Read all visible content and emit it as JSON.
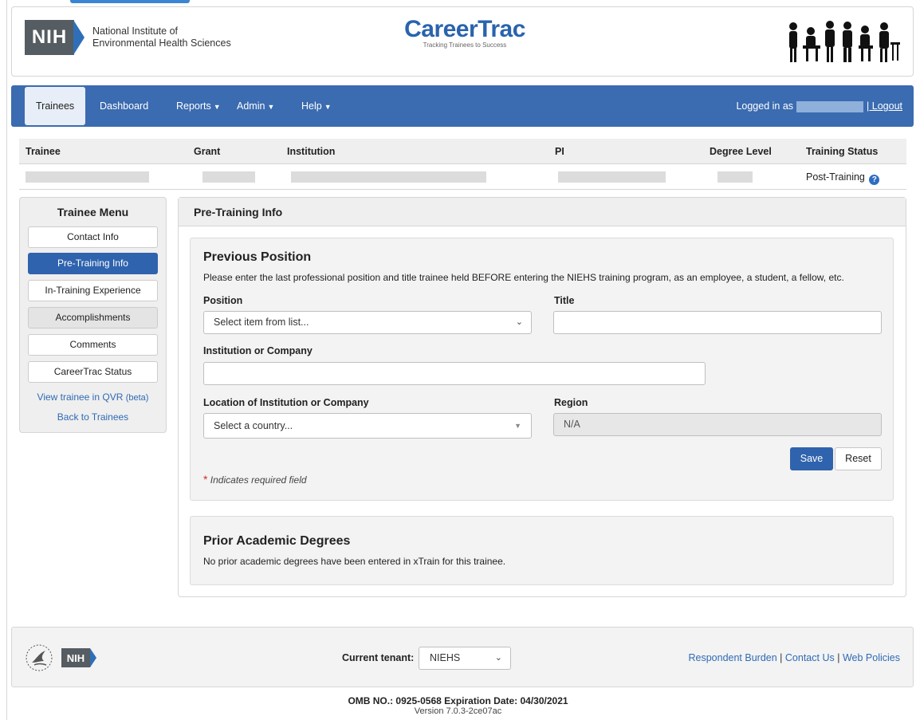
{
  "header": {
    "nih_abbr": "NIH",
    "institute_line1": "National Institute of",
    "institute_line2": "Environmental Health Sciences",
    "app_title": "CareerTrac",
    "app_tagline": "Tracking Trainees to Success"
  },
  "nav": {
    "items": [
      {
        "label": "Trainees"
      },
      {
        "label": "Dashboard"
      },
      {
        "label": "Reports"
      },
      {
        "label": "Admin"
      },
      {
        "label": "Help"
      }
    ],
    "logged_in_label": "Logged in as",
    "logout_label": "| Logout"
  },
  "trainee_table": {
    "headers": [
      "Trainee",
      "Grant",
      "Institution",
      "PI",
      "Degree Level",
      "Training Status"
    ],
    "training_status": "Post-Training",
    "help_icon_glyph": "?"
  },
  "side_menu": {
    "title": "Trainee Menu",
    "items": [
      {
        "label": "Contact Info"
      },
      {
        "label": "Pre-Training Info"
      },
      {
        "label": "In-Training Experience"
      },
      {
        "label": "Accomplishments"
      },
      {
        "label": "Comments"
      },
      {
        "label": "CareerTrac Status"
      }
    ],
    "link_qvr": "View trainee in QVR",
    "link_qvr_beta": "(beta)",
    "link_back": "Back to Trainees"
  },
  "main": {
    "panel_title": "Pre-Training Info",
    "previous_position": {
      "title": "Previous Position",
      "description": "Please enter the last professional position and title trainee held BEFORE entering the NIEHS training program, as an employee, a student, a fellow, etc.",
      "position_label": "Position",
      "position_value": "Select item from list...",
      "title_label": "Title",
      "title_value": "",
      "institution_label": "Institution or Company",
      "institution_value": "",
      "location_label": "Location of Institution or Company",
      "location_value": "Select a country...",
      "region_label": "Region",
      "region_value": "N/A",
      "save_label": "Save",
      "reset_label": "Reset",
      "required_star": "*",
      "required_note": "Indicates required field"
    },
    "prior_degrees": {
      "title": "Prior Academic Degrees",
      "description": "No prior academic degrees have been entered in xTrain for this trainee."
    }
  },
  "footer": {
    "nih_abbr": "NIH",
    "tenant_label": "Current tenant:",
    "tenant_value": "NIEHS",
    "links": [
      "Respondent Burden",
      "Contact Us",
      "Web Policies"
    ],
    "omb": "OMB NO.: 0925-0568   Expiration Date: 04/30/2021",
    "version": "Version 7.0.3-2ce07ac"
  },
  "colors": {
    "nav_blue": "#3b6bb0",
    "button_blue": "#2f63ad",
    "link_blue": "#2f6ab5"
  }
}
